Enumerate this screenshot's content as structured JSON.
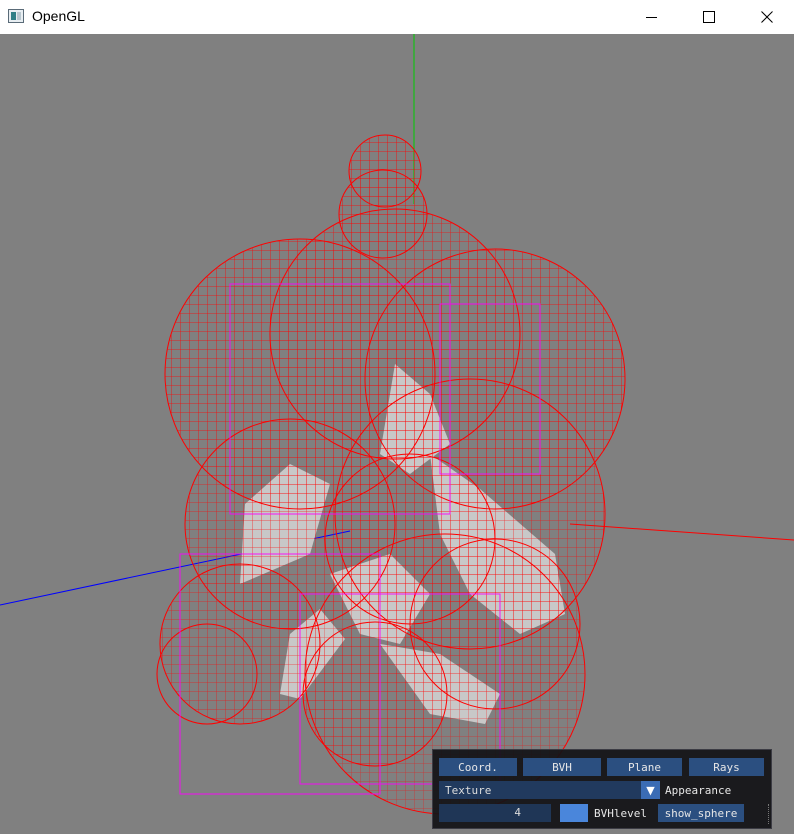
{
  "window": {
    "title": "OpenGL",
    "controls": [
      "minimize",
      "maximize",
      "close"
    ]
  },
  "scene": {
    "background": "#808080",
    "axes": {
      "x": "#ff0000",
      "y": "#00cc00",
      "z": "#0000ff"
    },
    "bounding_sphere_color": "#ff0000",
    "bvh_box_color": "#ff00ff",
    "mesh_color": "#c8c8c8"
  },
  "panel": {
    "buttons": [
      "Coord.",
      "BVH",
      "Plane",
      "Rays"
    ],
    "texture_combo": {
      "value": "Texture"
    },
    "appearance_label": "Appearance",
    "bvh_level": {
      "value": "4",
      "label": "BVHlevel"
    },
    "show_sphere_label": "show_sphere",
    "accent_color": "#4a86db"
  }
}
